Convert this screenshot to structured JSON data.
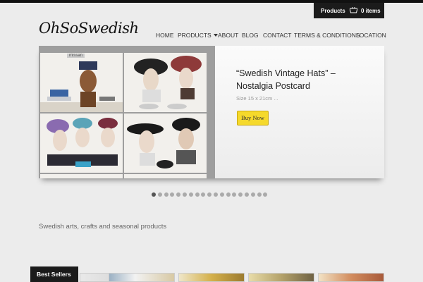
{
  "cart": {
    "products_label": "Products",
    "items_label": "0 items",
    "basket_icon": "basket-icon"
  },
  "logo": {
    "text": "OhSoSwedish"
  },
  "nav": [
    {
      "label": "HOME"
    },
    {
      "label": "PRODUCTS",
      "has_dropdown": true
    },
    {
      "label": "ABOUT"
    },
    {
      "label": "BLOG"
    },
    {
      "label": "CONTACT"
    },
    {
      "label": "TERMS & CONDITIONS"
    },
    {
      "label": "LOCATION"
    }
  ],
  "slider": {
    "title": "“Swedish Vintage Hats” – Nostalgia Postcard",
    "size_text": "Size 15 x 21cm ...",
    "button_label": "Buy Now",
    "photo_stamp": "missan",
    "slide_count": 19,
    "active_slide": 1
  },
  "tagline": "Swedish arts, crafts and seasonal products",
  "best_sellers": {
    "label": "Best Sellers"
  },
  "colors": {
    "accent": "#f5d92c",
    "dark": "#1b1b1b",
    "background": "#ececec"
  }
}
